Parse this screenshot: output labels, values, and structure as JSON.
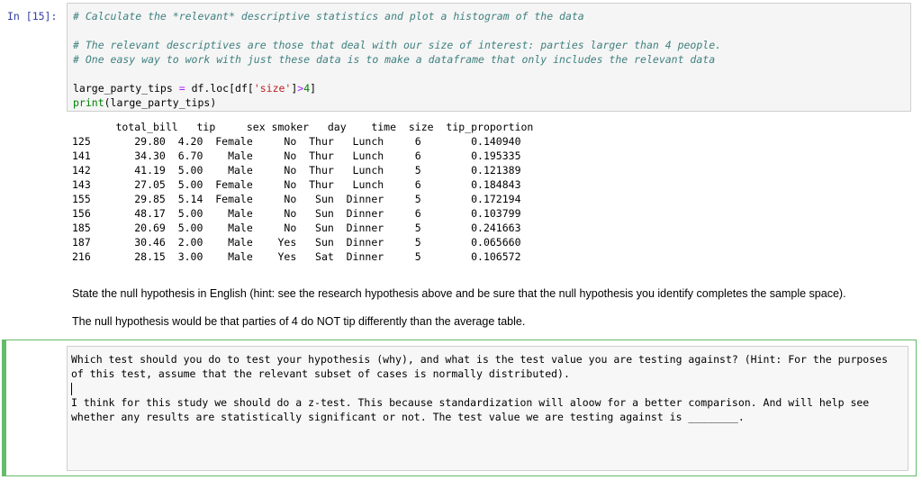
{
  "prompt": "In [15]:",
  "code": {
    "line1_comment": "# Calculate the *relevant* descriptive statistics and plot a histogram of the data",
    "line3_comment": "# The relevant descriptives are those that deal with our size of interest: parties larger than 4 people.",
    "line4_comment": "# One easy way to work with just these data is to make a dataframe that only includes the relevant data",
    "line6_var": "large_party_tips ",
    "line6_eq": "=",
    "line6_mid": " df.loc[df[",
    "line6_str": "'size'",
    "line6_close": "]",
    "line6_gt": ">",
    "line6_num": "4",
    "line6_end": "]",
    "line7_kw": "print",
    "line7_rest": "(large_party_tips)"
  },
  "table": {
    "header": "       total_bill   tip     sex smoker   day    time  size  tip_proportion",
    "rows": [
      "125       29.80  4.20  Female     No  Thur   Lunch     6        0.140940",
      "141       34.30  6.70    Male     No  Thur   Lunch     6        0.195335",
      "142       41.19  5.00    Male     No  Thur   Lunch     5        0.121389",
      "143       27.05  5.00  Female     No  Thur   Lunch     6        0.184843",
      "155       29.85  5.14  Female     No   Sun  Dinner     5        0.172194",
      "156       48.17  5.00    Male     No   Sun  Dinner     6        0.103799",
      "185       20.69  5.00    Male     No   Sun  Dinner     5        0.241663",
      "187       30.46  2.00    Male    Yes   Sun  Dinner     5        0.065660",
      "216       28.15  3.00    Male    Yes   Sat  Dinner     5        0.106572"
    ]
  },
  "markdown": {
    "question": "State the null hypothesis in English (hint: see the research hypothesis above and be sure that the null hypothesis you identify completes the sample space).",
    "answer": "The null hypothesis would be that parties of 4 do NOT tip differently than the average table."
  },
  "edit_cell": {
    "line1": "Which test should you do to test your hypothesis (why), and what is the test value you are testing against? (Hint: For the purposes of this test, assume that the relevant subset of cases is normally distributed).",
    "line3": "I think for this study we should do a z-test. This because standardization will aloow for a better comparison. And will help see whether any results are statistically significant or not. The test value we are testing against is ________."
  }
}
